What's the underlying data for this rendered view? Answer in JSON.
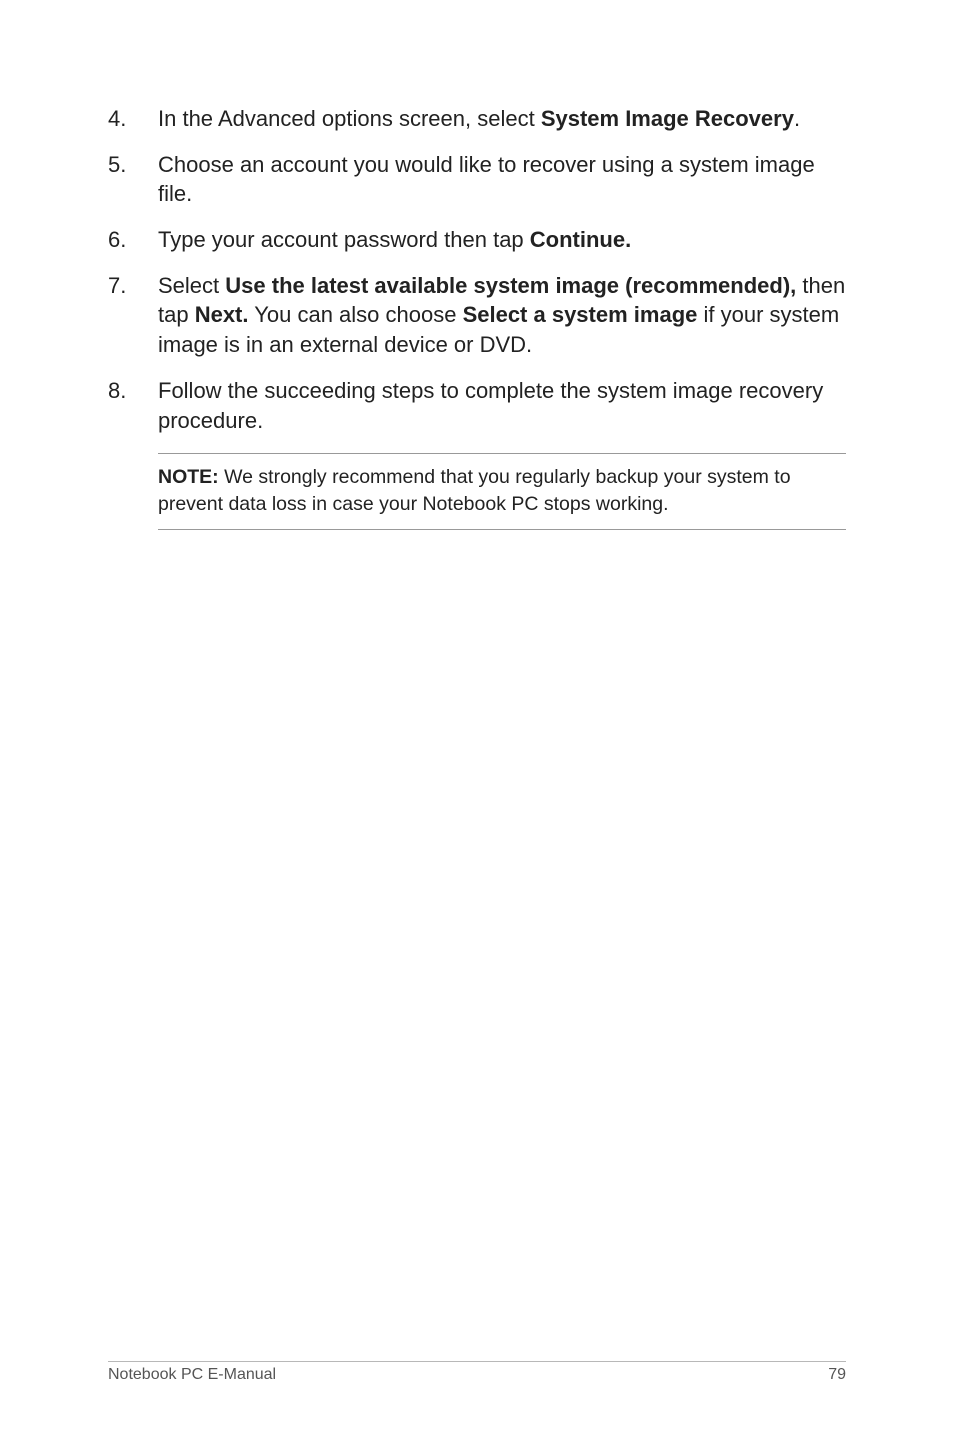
{
  "items": [
    {
      "num": "4.",
      "pre": "In the Advanced options screen, select ",
      "bold1": "System Image Recovery",
      "post": "."
    },
    {
      "num": "5.",
      "pre": "Choose an account you would like to recover using a system image file."
    },
    {
      "num": "6.",
      "pre": "Type your account password then tap ",
      "bold1": "Continue."
    },
    {
      "num": "7.",
      "pre": "Select ",
      "bold1": "Use the latest available system image (recommended),",
      "mid1": " then tap ",
      "bold2": "Next.",
      "mid2": " You can also choose ",
      "bold3": "Select a system image",
      "post": " if your system image is in an external device or DVD."
    },
    {
      "num": "8.",
      "pre": "Follow the succeeding steps to complete the system image recovery procedure."
    }
  ],
  "note": {
    "label": "NOTE:",
    "text": " We strongly recommend that you regularly backup your system to prevent data loss in case your Notebook PC stops working."
  },
  "footer": {
    "title": "Notebook PC E-Manual",
    "page": "79"
  }
}
